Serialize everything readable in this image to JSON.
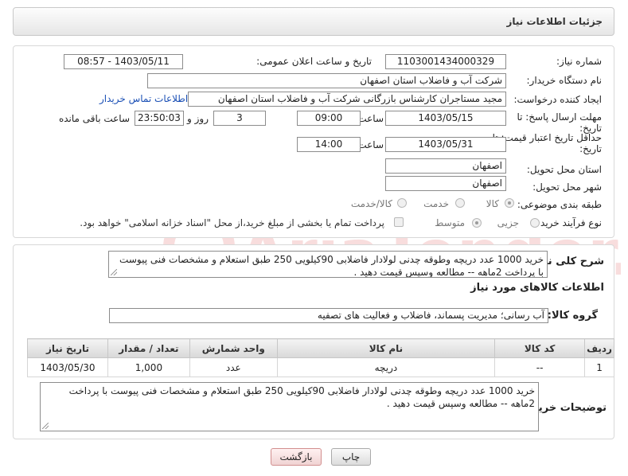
{
  "header": {
    "title": "جزئیات اطلاعات نیاز"
  },
  "form": {
    "need_number_label": "شماره نیاز:",
    "need_number": "1103001434000329",
    "announce_label": "تاریخ و ساعت اعلان عمومی:",
    "announce_value": "1403/05/11 - 08:57",
    "buyer_org_label": "نام دستگاه خریدار:",
    "buyer_org": "شرکت آب و فاضلاب استان اصفهان",
    "creator_label": "ایجاد کننده درخواست:",
    "creator": "مجید مستاجران کارشناس بازرگانی شرکت آب و فاضلاب استان اصفهان",
    "contact_link": "اطلاعات تماس خریدار",
    "deadline_label_1": "مهلت ارسال پاسخ: تا",
    "deadline_label_2": "تاریخ:",
    "deadline_date": "1403/05/15",
    "time_label": "ساعت",
    "deadline_time": "09:00",
    "days_value": "3",
    "days_label": "روز و",
    "remaining_time": "23:50:03",
    "remaining_label": "ساعت باقی مانده",
    "validity_label_1": "حداقل تاریخ اعتبار قیمت: تا",
    "validity_label_2": "تاریخ:",
    "validity_date": "1403/05/31",
    "validity_time": "14:00",
    "province_label": "استان محل تحویل:",
    "province": "اصفهان",
    "city_label": "شهر محل تحویل:",
    "city": "اصفهان",
    "category_label": "طبقه بندی موضوعی:",
    "category_options": [
      "کالا",
      "خدمت",
      "کالا/خدمت"
    ],
    "category_selected": "کالا",
    "process_label": "نوع فرآیند خرید :",
    "process_options": [
      "جزیی",
      "متوسط"
    ],
    "process_selected": "متوسط",
    "payment_note": "پرداخت تمام یا بخشی از مبلغ خرید،از محل \"اسناد خزانه اسلامی\" خواهد بود."
  },
  "description": {
    "label": "شرح کلی نیاز:",
    "text": "خرید 1000 عدد دریچه وطوقه چدنی لولادار  فاضلابی 90کیلویی 250 طبق استعلام و مشخصات فنی پیوست با پرداخت 2ماهه -- مطالعه وسپس قیمت دهید ."
  },
  "goods": {
    "section_title": "اطلاعات کالاهای مورد نیاز",
    "group_label": "گروه کالا:",
    "group_value": "آب رسانی؛ مدیریت پسماند، فاضلاب و فعالیت های تصفیه",
    "columns": [
      "ردیف",
      "کد کالا",
      "نام کالا",
      "واحد شمارش",
      "تعداد / مقدار",
      "تاریخ نیاز"
    ],
    "rows": [
      {
        "row": "1",
        "code": "--",
        "name": "دریچه",
        "unit": "عدد",
        "qty": "1,000",
        "date": "1403/05/30"
      }
    ]
  },
  "buyer_notes": {
    "label": "توضیحات خریدار:",
    "text": "خرید 1000 عدد دریچه وطوقه چدنی لولادار  فاضلابی 90کیلویی 250 طبق استعلام و مشخصات فنی پیوست با پرداخت 2ماهه -- مطالعه وسپس قیمت دهید ."
  },
  "buttons": {
    "print": "چاپ",
    "back": "بازگشت"
  },
  "watermark": {
    "text": "AriaTender.neT"
  }
}
